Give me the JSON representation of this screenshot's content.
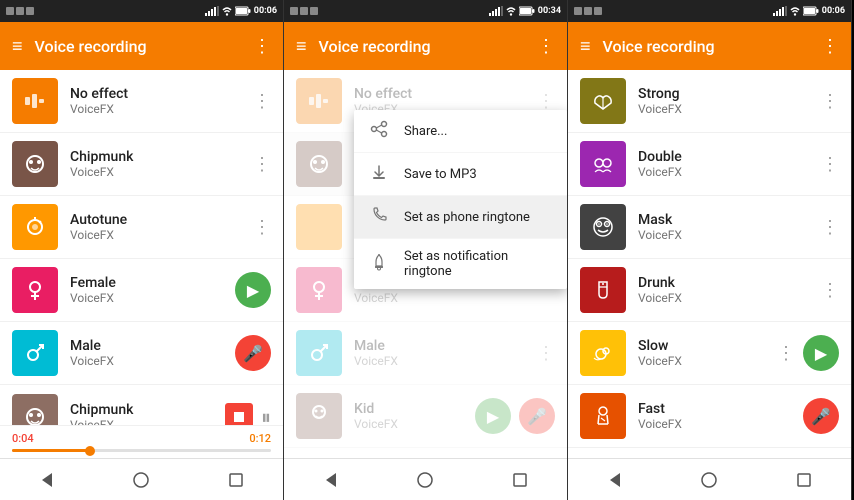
{
  "screens": [
    {
      "id": "screen1",
      "status_time": "00:06",
      "title": "Voice recording",
      "items": [
        {
          "name": "No effect",
          "subtitle": "VoiceFX",
          "icon_class": "icon-orange",
          "icon_char": "🎵",
          "has_play": false,
          "has_mic": false,
          "is_recording": false
        },
        {
          "name": "Chipmunk",
          "subtitle": "VoiceFX",
          "icon_class": "icon-brown",
          "icon_char": "🐿",
          "has_play": false,
          "has_mic": false,
          "is_recording": false
        },
        {
          "name": "Autotune",
          "subtitle": "VoiceFX",
          "icon_class": "icon-orange2",
          "icon_char": "🎤",
          "has_play": false,
          "has_mic": false,
          "is_recording": false
        },
        {
          "name": "Female",
          "subtitle": "VoiceFX",
          "icon_class": "icon-pink",
          "icon_char": "♀",
          "has_play": true,
          "has_mic": false,
          "is_recording": false
        },
        {
          "name": "Male",
          "subtitle": "VoiceFX",
          "icon_class": "icon-cyan",
          "icon_char": "♂",
          "has_play": false,
          "has_mic": true,
          "is_recording": false
        },
        {
          "name": "Chipmunk",
          "subtitle": "VoiceFX",
          "icon_class": "icon-tan",
          "icon_char": "🐿",
          "has_play": false,
          "has_mic": false,
          "is_recording": true
        }
      ],
      "recording_time_start": "0:04",
      "recording_time_end": "0:12"
    },
    {
      "id": "screen2",
      "status_time": "00:34",
      "title": "Voice recording",
      "items": [
        {
          "name": "No effect",
          "subtitle": "VoiceFX",
          "icon_class": "icon-orange",
          "icon_char": "🎵",
          "has_play": false,
          "has_mic": false,
          "menu_open": false
        },
        {
          "name": "Chipmunk",
          "subtitle": "VoiceFX",
          "icon_class": "icon-brown",
          "icon_char": "🐿",
          "has_play": false,
          "has_mic": false,
          "menu_open": true
        },
        {
          "name": "Autotune",
          "subtitle": "VoiceFX",
          "icon_class": "icon-orange2",
          "icon_char": "🎤",
          "has_play": false,
          "has_mic": false,
          "menu_open": false
        },
        {
          "name": "Female",
          "subtitle": "VoiceFX",
          "icon_class": "icon-pink",
          "icon_char": "♀",
          "has_play": false,
          "has_mic": false,
          "menu_open": false
        },
        {
          "name": "Male",
          "subtitle": "VoiceFX",
          "icon_class": "icon-cyan",
          "icon_char": "♂",
          "has_play": false,
          "has_mic": false,
          "menu_open": false
        },
        {
          "name": "Kid",
          "subtitle": "VoiceFX",
          "icon_class": "icon-tan",
          "icon_char": "👶",
          "has_play": true,
          "has_mic": true,
          "menu_open": false
        }
      ],
      "context_menu": {
        "items": [
          {
            "icon": "share",
            "label": "Share..."
          },
          {
            "icon": "save",
            "label": "Save to MP3"
          },
          {
            "icon": "phone",
            "label": "Set as phone ringtone"
          },
          {
            "icon": "bell",
            "label": "Set as notification ringtone"
          }
        ]
      }
    },
    {
      "id": "screen3",
      "status_time": "00:06",
      "title": "Voice recording",
      "items": [
        {
          "name": "Strong",
          "subtitle": "VoiceFX",
          "icon_class": "icon-olive",
          "icon_char": "💪"
        },
        {
          "name": "Double",
          "subtitle": "VoiceFX",
          "icon_class": "icon-purple",
          "icon_char": "👥"
        },
        {
          "name": "Mask",
          "subtitle": "VoiceFX",
          "icon_class": "icon-darkgray",
          "icon_char": "😷"
        },
        {
          "name": "Drunk",
          "subtitle": "VoiceFX",
          "icon_class": "icon-darkred",
          "icon_char": "🍷"
        },
        {
          "name": "Slow",
          "subtitle": "VoiceFX",
          "icon_class": "icon-amber",
          "icon_char": "🐌",
          "has_play": true
        },
        {
          "name": "Fast",
          "subtitle": "VoiceFX",
          "icon_class": "icon-darkorange",
          "icon_char": "🏃",
          "has_mic": true
        }
      ]
    }
  ],
  "nav": {
    "back_label": "◁",
    "home_label": "○",
    "square_label": "□"
  },
  "menu_icon": "≡",
  "more_icon": "⋮"
}
